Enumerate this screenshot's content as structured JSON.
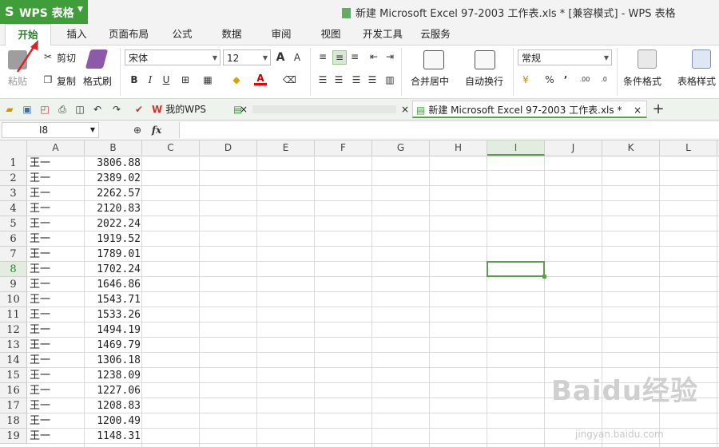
{
  "app": {
    "logo": "S",
    "name": "WPS 表格",
    "dropdown_icon": "chevron-down-icon"
  },
  "window_title": "新建 Microsoft Excel 97-2003 工作表.xls * [兼容模式] - WPS 表格",
  "menu_tabs": [
    "开始",
    "插入",
    "页面布局",
    "公式",
    "数据",
    "审阅",
    "视图",
    "开发工具",
    "云服务"
  ],
  "active_menu_tab": "开始",
  "ribbon": {
    "paste": "粘贴",
    "cut": "剪切",
    "copy": "复制",
    "format_painter": "格式刷",
    "font_name": "宋体",
    "font_size": "12",
    "bold": "B",
    "italic": "I",
    "underline": "U",
    "merge_center": "合并居中",
    "wrap_text": "自动换行",
    "number_format": "常规",
    "percent": "%",
    "comma": "’",
    "cond_format": "条件格式",
    "table_style": "表格样式"
  },
  "doc_tabs": [
    {
      "label": "我的WPS",
      "icon": "wps-logo-icon"
    },
    {
      "label": "",
      "icon": "spreadsheet-icon"
    },
    {
      "label": "新建 Microsoft Excel 97-2003 工作表.xls *",
      "icon": "spreadsheet-icon"
    }
  ],
  "name_box": "I8",
  "formula_icons": [
    "zoom-icon",
    "fx-icon"
  ],
  "fx_label": "fx",
  "columns": [
    "A",
    "B",
    "C",
    "D",
    "E",
    "F",
    "G",
    "H",
    "I",
    "J",
    "K",
    "L"
  ],
  "selected_column": "I",
  "selected_row": "8",
  "rows": [
    {
      "n": "1",
      "a": "王一",
      "b": "3806.88"
    },
    {
      "n": "2",
      "a": "王一",
      "b": "2389.02"
    },
    {
      "n": "3",
      "a": "王一",
      "b": "2262.57"
    },
    {
      "n": "4",
      "a": "王一",
      "b": "2120.83"
    },
    {
      "n": "5",
      "a": "王一",
      "b": "2022.24"
    },
    {
      "n": "6",
      "a": "王一",
      "b": "1919.52"
    },
    {
      "n": "7",
      "a": "王一",
      "b": "1789.01"
    },
    {
      "n": "8",
      "a": "王一",
      "b": "1702.24"
    },
    {
      "n": "9",
      "a": "王一",
      "b": "1646.86"
    },
    {
      "n": "10",
      "a": "王一",
      "b": "1543.71"
    },
    {
      "n": "11",
      "a": "王一",
      "b": "1533.26"
    },
    {
      "n": "12",
      "a": "王一",
      "b": "1494.19"
    },
    {
      "n": "13",
      "a": "王一",
      "b": "1469.79"
    },
    {
      "n": "14",
      "a": "王一",
      "b": "1306.18"
    },
    {
      "n": "15",
      "a": "王一",
      "b": "1238.09"
    },
    {
      "n": "16",
      "a": "王一",
      "b": "1227.06"
    },
    {
      "n": "17",
      "a": "王一",
      "b": "1208.83"
    },
    {
      "n": "18",
      "a": "王一",
      "b": "1200.49"
    },
    {
      "n": "19",
      "a": "王一",
      "b": "1148.31"
    }
  ],
  "watermark": {
    "text": "Baidu经验",
    "url": "jingyan.baidu.com"
  },
  "colors": {
    "accent": "#3f9e3a",
    "selection": "#5aa04c",
    "annotation_arrow": "#e02020"
  }
}
